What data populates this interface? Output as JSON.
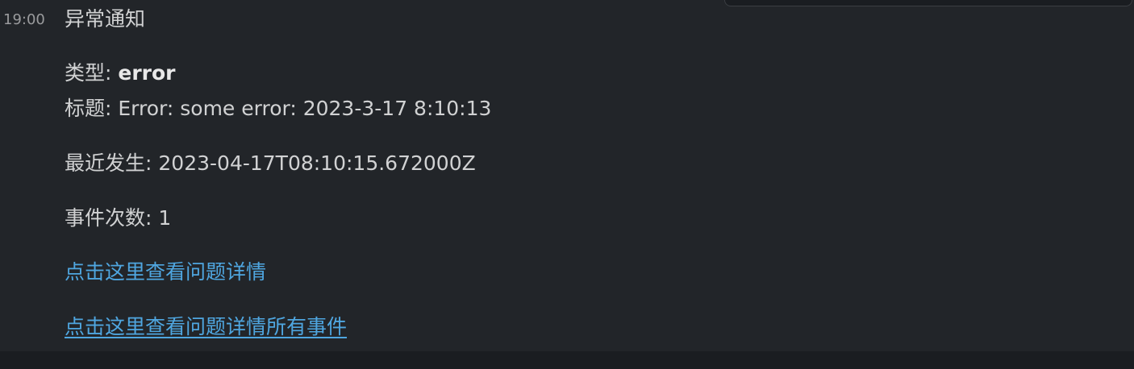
{
  "message": {
    "time": "19:00",
    "title": "异常通知",
    "type_label": "类型:",
    "type_value": "error",
    "subject_label": "标题:",
    "subject_value": "Error: some error: 2023-3-17 8:10:13",
    "last_seen_label": "最近发生:",
    "last_seen_value": "2023-04-17T08:10:15.672000Z",
    "event_count_label": "事件次数:",
    "event_count_value": "1",
    "issue_link": "点击这里查看问题详情",
    "all_events_link": "点击这里查看问题详情所有事件"
  },
  "colors": {
    "background": "#222529",
    "text": "#d1d2d3",
    "link": "#4fa6e0",
    "timestamp": "#9a9b9d"
  }
}
